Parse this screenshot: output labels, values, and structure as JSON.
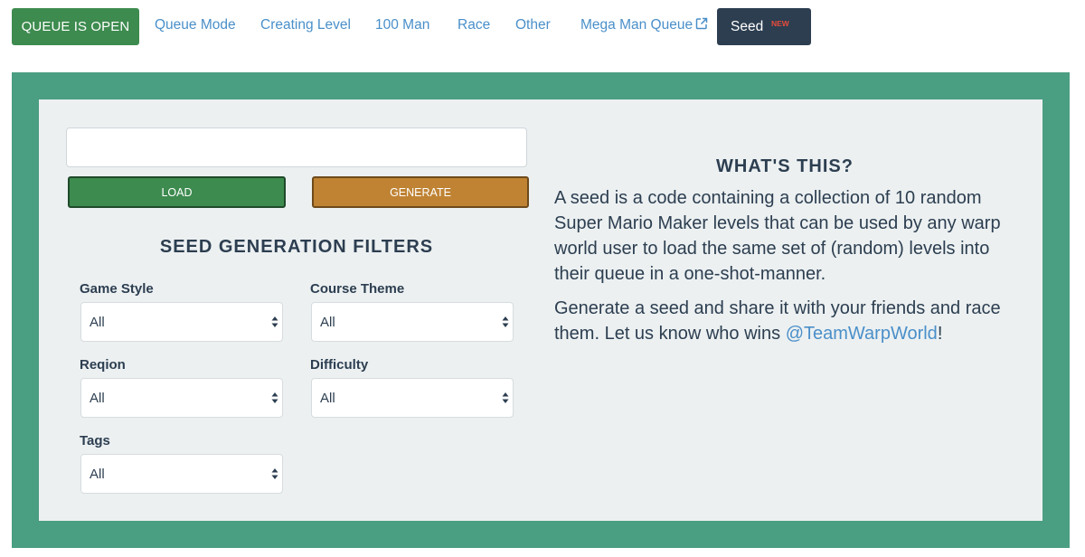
{
  "nav": {
    "queue_status_label": "QUEUE IS OPEN",
    "links": [
      "Queue Mode",
      "Creating Level",
      "100 Man",
      "Race",
      "Other",
      "Mega Man Queue"
    ],
    "seed_tab_label": "Seed",
    "seed_badge": "NEW"
  },
  "seed_form": {
    "input_value": "",
    "load_label": "LOAD",
    "generate_label": "GENERATE"
  },
  "filters": {
    "title": "SEED GENERATION FILTERS",
    "game_style": {
      "label": "Game Style",
      "value": "All"
    },
    "course_theme": {
      "label": "Course Theme",
      "value": "All"
    },
    "region": {
      "label": "Reqion",
      "value": "All"
    },
    "difficulty": {
      "label": "Difficulty",
      "value": "All"
    },
    "tags": {
      "label": "Tags",
      "value": "All"
    }
  },
  "info": {
    "title": "WHAT'S THIS?",
    "paragraph1": "A seed is a code containing a collection of 10 random Super Mario Maker levels that can be used by any warp world user to load the same set of (random) levels into their queue in a one-shot-manner.",
    "paragraph2_text": "Generate a seed and share it with your friends and race them. Let us know who wins ",
    "paragraph2_link": "@TeamWarpWorld",
    "paragraph2_end": "!"
  },
  "colors": {
    "accent_green": "#3d8b4f",
    "frame_green": "#4a9e81",
    "generate_orange": "#bf8333",
    "link_blue": "#4a8fc9",
    "dark_navy": "#2c3e50",
    "badge_red": "#e74c3c"
  },
  "icons": {
    "external_link": "external-link-icon",
    "select_arrows": "select-arrows-icon"
  }
}
